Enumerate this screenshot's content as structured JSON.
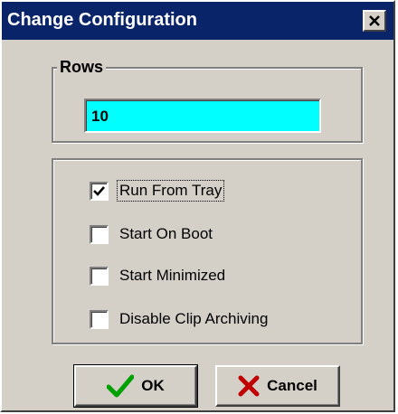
{
  "window": {
    "title": "Change Configuration"
  },
  "rows": {
    "legend": "Rows",
    "value": "10"
  },
  "options": [
    {
      "label": "Run From Tray",
      "checked": true
    },
    {
      "label": "Start On Boot",
      "checked": false
    },
    {
      "label": "Start Minimized",
      "checked": false
    },
    {
      "label": "Disable Clip Archiving",
      "checked": false
    }
  ],
  "buttons": {
    "ok_label": "OK",
    "cancel_label": "Cancel"
  },
  "icons": {
    "ok": "checkmark-icon",
    "cancel": "x-icon",
    "close": "close-icon"
  },
  "colors": {
    "titlebar": "#0a246a",
    "input_bg": "#00ffff",
    "ok_icon": "#00a000",
    "cancel_icon": "#c00000"
  }
}
